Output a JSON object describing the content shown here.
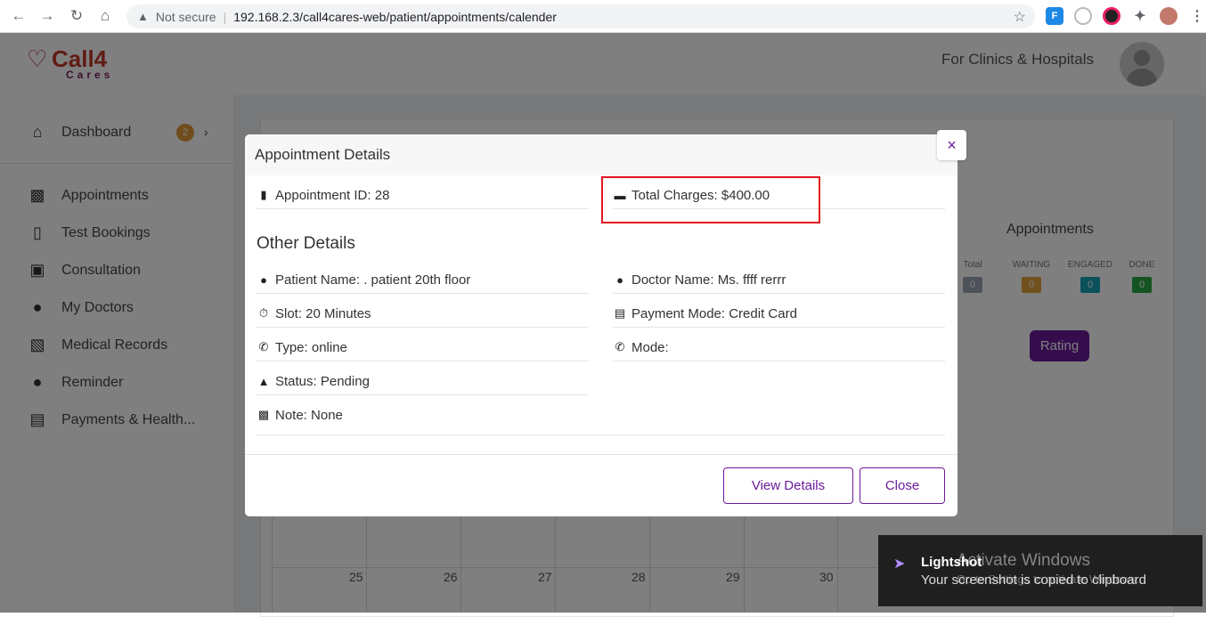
{
  "browser": {
    "security_label": "Not secure",
    "url": "192.168.2.3/call4cares-web/patient/appointments/calender"
  },
  "header": {
    "logo_main": "Call4",
    "logo_sub": "Cares",
    "tagline": "For Clinics & Hospitals"
  },
  "sidebar": {
    "dashboard": {
      "label": "Dashboard",
      "badge": "2"
    },
    "items": [
      {
        "label": "Appointments",
        "icon": "clipboard-icon"
      },
      {
        "label": "Test Bookings",
        "icon": "test-tubes-icon"
      },
      {
        "label": "Consultation",
        "icon": "monitor-plus-icon"
      },
      {
        "label": "My Doctors",
        "icon": "chat-plus-icon"
      },
      {
        "label": "Medical Records",
        "icon": "medical-file-icon"
      },
      {
        "label": "Reminder",
        "icon": "chat-plus-icon"
      },
      {
        "label": "Payments & Health...",
        "icon": "dollar-file-icon"
      }
    ]
  },
  "panel": {
    "title": "Appointments",
    "stats": [
      {
        "label": "Total",
        "value": "0",
        "color": "#9aa5b1"
      },
      {
        "label": "WAITING",
        "value": "0",
        "color": "#e3a03a"
      },
      {
        "label": "ENGAGED",
        "value": "0",
        "color": "#17a2b8"
      },
      {
        "label": "DONE",
        "value": "0",
        "color": "#28a745"
      }
    ],
    "rating_label": "Rating"
  },
  "calendar": {
    "days": [
      "25",
      "26",
      "27",
      "28",
      "29",
      "30"
    ]
  },
  "modal": {
    "title": "Appointment Details",
    "appointment_id": "Appointment ID: 28",
    "total_charges": "Total Charges: $400.00",
    "other_details_title": "Other Details",
    "patient_name": "Patient Name: . patient 20th floor",
    "doctor_name": "Doctor Name: Ms. ffff rerrr",
    "slot": "Slot: 20 Minutes",
    "payment_mode": "Payment Mode: Credit Card",
    "type": "Type: online",
    "mode": "Mode:",
    "status": "Status: Pending",
    "note": "Note: None",
    "view_details_label": "View Details",
    "close_label": "Close",
    "close_x": "×"
  },
  "toast": {
    "title": "Lightshot",
    "message": "Your screenshot is copied to clipboard"
  },
  "watermark": {
    "title": "Activate Windows",
    "subtitle": "Go to Settings to activate Windows."
  }
}
